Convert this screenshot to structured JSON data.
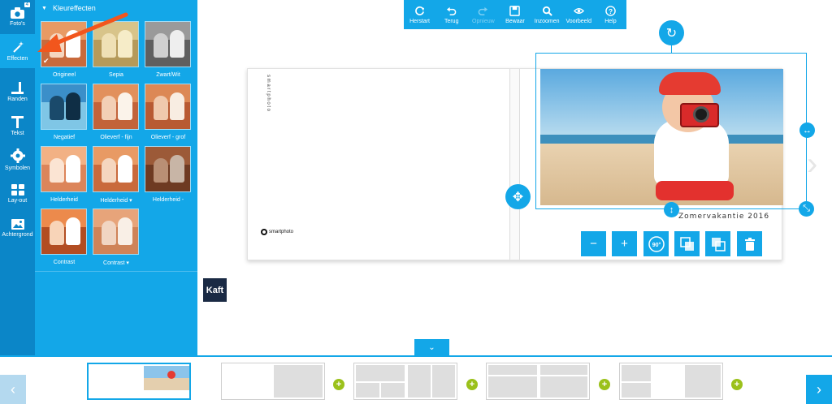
{
  "nav": {
    "items": [
      {
        "label": "Foto's",
        "icon": "camera-icon",
        "badge": "4"
      },
      {
        "label": "Effecten",
        "icon": "magic-wand-icon",
        "active": true
      },
      {
        "label": "Randen",
        "icon": "border-icon"
      },
      {
        "label": "Tekst",
        "icon": "text-icon"
      },
      {
        "label": "Symbolen",
        "icon": "gear-icon"
      },
      {
        "label": "Lay-out",
        "icon": "layout-icon"
      },
      {
        "label": "Achtergrond",
        "icon": "image-icon"
      }
    ]
  },
  "panel": {
    "title": "Kleureffecten",
    "effects": [
      {
        "label": "Origineel",
        "selected": true
      },
      {
        "label": "Sepia"
      },
      {
        "label": "Zwart/Wit"
      },
      {
        "label": "Negatief"
      },
      {
        "label": "Olieverf - fijn"
      },
      {
        "label": "Olieverf - grof"
      },
      {
        "label": "Helderheid"
      },
      {
        "label": "Helderheid ▾"
      },
      {
        "label": "Helderheid -"
      },
      {
        "label": "Contrast"
      },
      {
        "label": "Contrast ▾"
      }
    ]
  },
  "toolbar": {
    "buttons": [
      {
        "label": "Herstart",
        "icon": "refresh-icon"
      },
      {
        "label": "Terug",
        "icon": "undo-icon"
      },
      {
        "label": "Opnieuw",
        "icon": "redo-icon",
        "disabled": true
      },
      {
        "label": "Bewaar",
        "icon": "save-icon"
      },
      {
        "label": "Inzoomen",
        "icon": "zoom-icon"
      },
      {
        "label": "Voorbeeld",
        "icon": "eye-icon"
      },
      {
        "label": "Help",
        "icon": "help-icon"
      }
    ]
  },
  "canvas": {
    "spine_text": "s m a r t p h o t o",
    "logo_text": "smartphoto",
    "photo_caption": "Zomervakantie 2016",
    "rotate_label": "90°",
    "actions": [
      "minus-icon",
      "plus-icon",
      "rotate-90-icon",
      "bring-forward-icon",
      "send-backward-icon",
      "delete-icon"
    ]
  },
  "kaft_label": "Kaft",
  "colors": {
    "accent": "#13a7e8",
    "nav_dark": "#0b86c8",
    "kaft": "#1a2a44",
    "add_page": "#9bc11b",
    "annotation_arrow": "#f2561d"
  }
}
